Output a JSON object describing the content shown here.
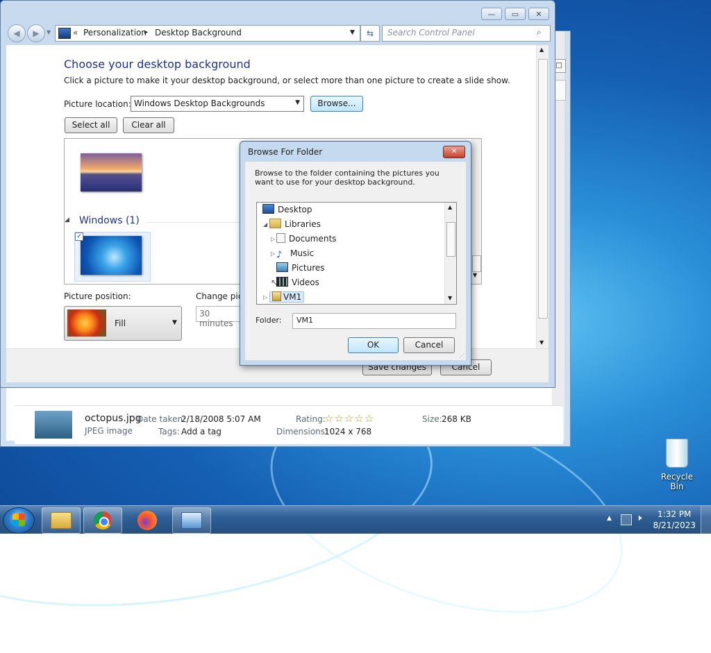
{
  "desktop": {
    "recycle_bin": "Recycle Bin"
  },
  "details_pane": {
    "filename": "octopus.jpg",
    "filetype": "JPEG image",
    "date_label": "Date taken:",
    "date_value": "2/18/2008 5:07 AM",
    "tags_label": "Tags:",
    "tags_value": "Add a tag",
    "rating_label": "Rating:",
    "rating_stars": "☆☆☆☆☆",
    "dimensions_label": "Dimensions:",
    "dimensions_value": "1024 x 768",
    "size_label": "Size:",
    "size_value": "268 KB"
  },
  "window": {
    "caption": {
      "minimize": "—",
      "maximize": "▭",
      "close": "✕"
    },
    "address": {
      "chevrons": "«",
      "crumb1": "Personalization",
      "sep": "▸",
      "crumb2": "Desktop Background"
    },
    "search": {
      "placeholder": "Search Control Panel"
    },
    "heading": "Choose your desktop background",
    "description": "Click a picture to make it your desktop background, or select more than one picture to create a slide show.",
    "picture_location_label": "Picture location:",
    "picture_location_value": "Windows Desktop Backgrounds",
    "browse_button": "Browse...",
    "select_all": "Select all",
    "clear_all": "Clear all",
    "group_label": "Windows (1)",
    "picture_position_label": "Picture position:",
    "picture_position_value": "Fill",
    "change_picture_label": "Change pict",
    "interval_value": "30 minutes",
    "save_changes": "Save changes",
    "cancel": "Cancel"
  },
  "dialog": {
    "title": "Browse For Folder",
    "description": "Browse to the folder containing the pictures you want to use for your desktop background.",
    "tree": [
      {
        "label": "Desktop"
      },
      {
        "label": "Libraries"
      },
      {
        "label": "Documents"
      },
      {
        "label": "Music"
      },
      {
        "label": "Pictures"
      },
      {
        "label": "Videos"
      },
      {
        "label": "VM1"
      }
    ],
    "folder_label": "Folder:",
    "folder_value": "VM1",
    "ok": "OK",
    "cancel": "Cancel"
  },
  "taskbar": {
    "time": "1:32 PM",
    "date": "8/21/2023"
  }
}
